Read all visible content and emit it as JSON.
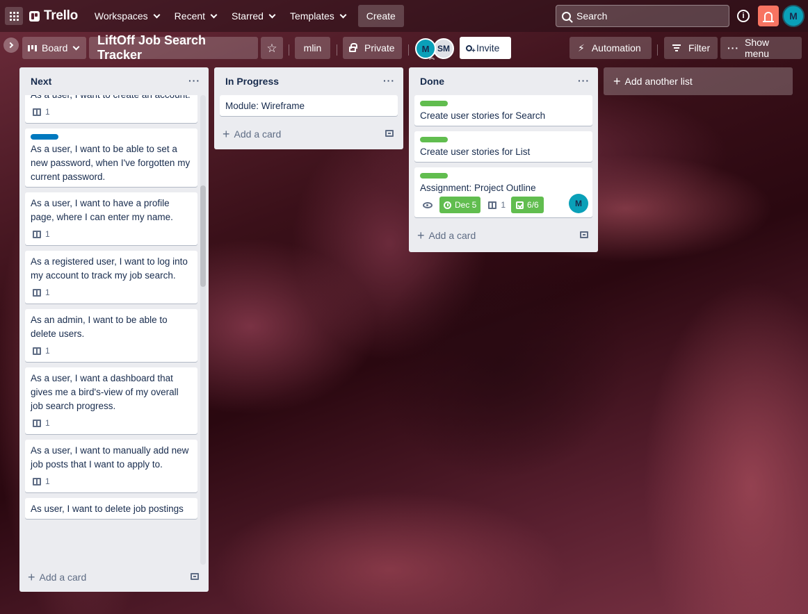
{
  "header": {
    "logo_text": "Trello",
    "nav": [
      {
        "label": "Workspaces"
      },
      {
        "label": "Recent"
      },
      {
        "label": "Starred"
      },
      {
        "label": "Templates"
      }
    ],
    "create_label": "Create",
    "search_placeholder": "Search",
    "info_icon": "i",
    "user_initial": "M"
  },
  "board": {
    "view_label": "Board",
    "title": "LiftOff Job Search Tracker",
    "workspace": "mlin",
    "visibility": "Private",
    "members": [
      {
        "initials": "M"
      },
      {
        "initials": "SM"
      }
    ],
    "invite_label": "Invite",
    "automation_label": "Automation",
    "filter_label": "Filter",
    "show_menu_label": "Show menu"
  },
  "colors": {
    "label_blue": "#0079bf",
    "label_green": "#61bd4f",
    "notification": "#f87462",
    "avatar": "#0aa0b8"
  },
  "lists": {
    "next": {
      "title": "Next",
      "cards": [
        {
          "text": "As a user, I want to create an account.",
          "desc_count": "1"
        },
        {
          "text": "As a user, I want to be able to set a new password, when I've forgotten my current password."
        },
        {
          "text": "As a user, I want to have a profile page, where I can enter my name.",
          "desc_count": "1"
        },
        {
          "text": "As a registered user, I want to log into my account to track my job search.",
          "desc_count": "1"
        },
        {
          "text": "As an admin, I want to be able to delete users.",
          "desc_count": "1"
        },
        {
          "text": "As a user, I want a dashboard that gives me a bird's-view of my overall job search progress.",
          "desc_count": "1"
        },
        {
          "text": "As a user, I want to manually add new job posts that I want to apply to.",
          "desc_count": "1"
        },
        {
          "text": "As user, I want to delete job postings"
        }
      ],
      "add_card_label": "Add a card"
    },
    "in_progress": {
      "title": "In Progress",
      "cards": [
        {
          "text": "Module: Wireframe"
        }
      ],
      "add_card_label": "Add a card"
    },
    "done": {
      "title": "Done",
      "cards": [
        {
          "text": "Create user stories for Search"
        },
        {
          "text": "Create user stories for List"
        },
        {
          "text": "Assignment: Project Outline",
          "due": "Dec 5",
          "desc_count": "1",
          "checklist": "6/6",
          "member": "M"
        }
      ],
      "add_card_label": "Add a card"
    }
  },
  "add_list_label": "Add another list"
}
